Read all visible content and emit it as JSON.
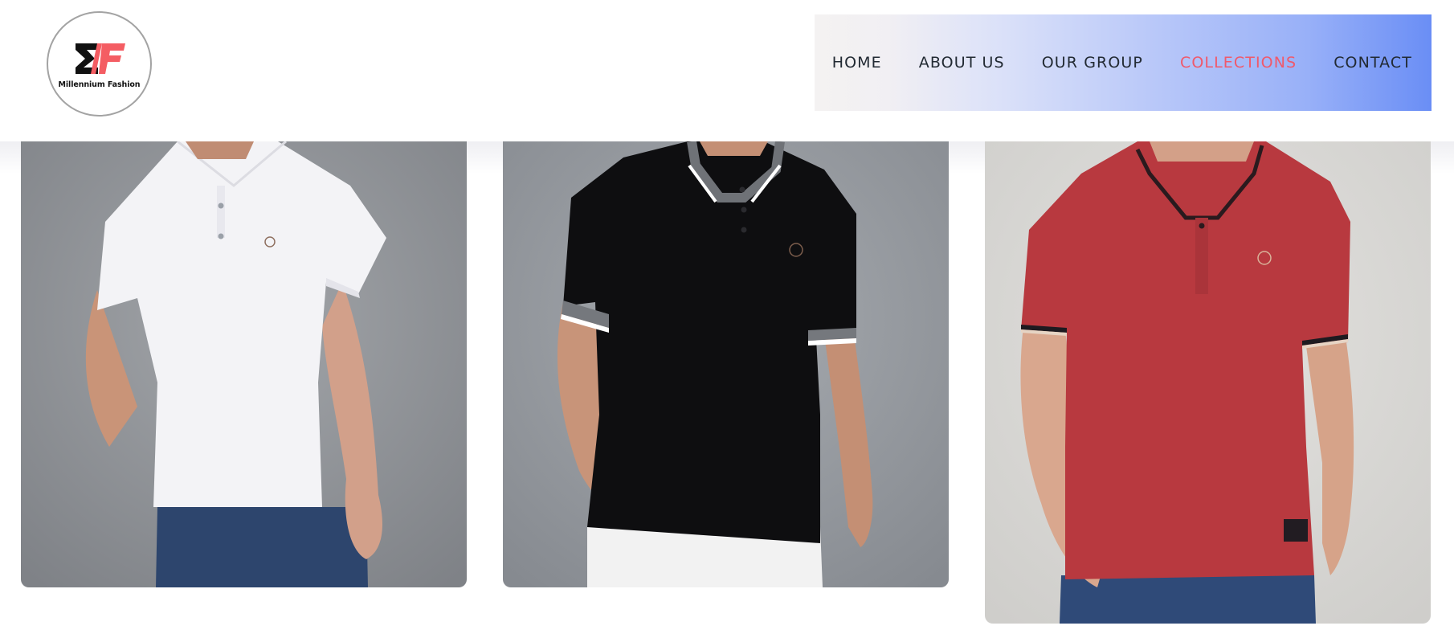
{
  "brand": {
    "name": "Millennium Fashion",
    "colors": {
      "mark_dark": "#111111",
      "mark_accent": "#f45d63"
    }
  },
  "nav": {
    "items": [
      {
        "label": "HOME",
        "active": false
      },
      {
        "label": "ABOUT US",
        "active": false
      },
      {
        "label": "OUR GROUP",
        "active": false
      },
      {
        "label": "COLLECTIONS",
        "active": true
      },
      {
        "label": "CONTACT",
        "active": false
      }
    ],
    "colors": {
      "text": "#222a33",
      "active": "#f0596b",
      "gradient_start": "#f4f2f2",
      "gradient_end": "#6a8ef5"
    }
  },
  "products": [
    {
      "image": "white-polo-shirt-photo",
      "shirt_color": "#f3f3f6",
      "background": "#8e9196"
    },
    {
      "image": "black-polo-shirt-photo",
      "shirt_color": "#0d0d0f",
      "background": "#969aa0"
    },
    {
      "image": "red-polo-shirt-photo",
      "shirt_color": "#b8393f",
      "background": "#dcdbd8"
    }
  ]
}
